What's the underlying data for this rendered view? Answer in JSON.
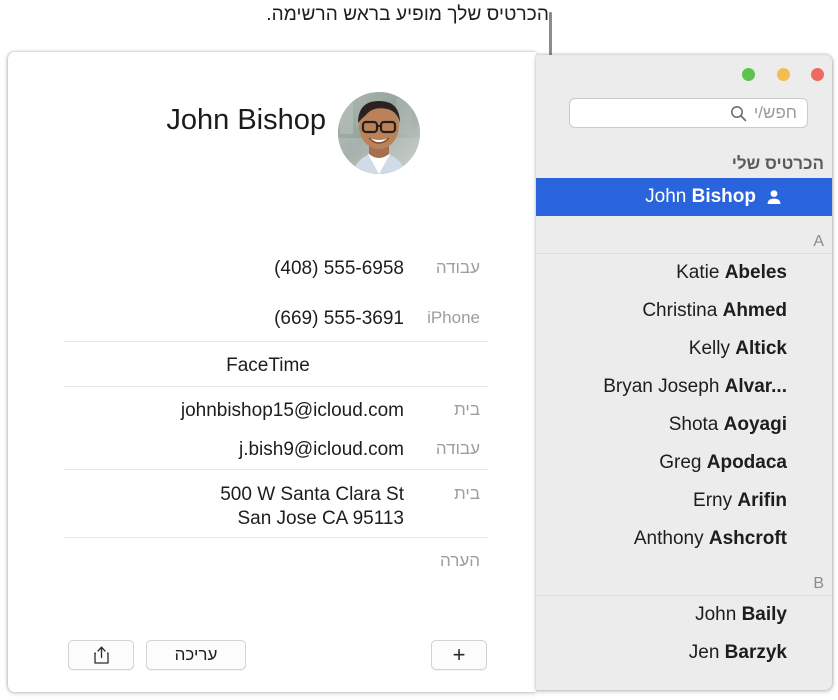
{
  "callout": {
    "text": "הכרטיס שלך מופיע בראש הרשימה."
  },
  "card": {
    "name": "John Bishop",
    "avatar_icon": "contact-photo",
    "fields": [
      {
        "label": "עבודה",
        "value": "(408) 555-6958",
        "type": "phone"
      },
      {
        "label": "iPhone",
        "value": "(669) 555-3691",
        "type": "phone"
      },
      {
        "label": "",
        "value": "FaceTime",
        "type": "facetime"
      },
      {
        "label": "בית",
        "value": "johnbishop15@icloud.com",
        "type": "email"
      },
      {
        "label": "עבודה",
        "value": "j.bish9@icloud.com",
        "type": "email"
      },
      {
        "label": "בית",
        "value": "500 W Santa Clara St\nSan Jose CA 95113",
        "type": "address"
      },
      {
        "label": "הערה",
        "value": "",
        "type": "note"
      }
    ],
    "address_line1": "500 W Santa Clara St",
    "address_line2": "San Jose CA 95113",
    "toolbar": {
      "share_icon": "share-icon",
      "edit_label": "עריכה",
      "add_label": "+"
    }
  },
  "window": {
    "traffic_lights": {
      "green": "#5cc44c",
      "yellow": "#f4bd4f",
      "red": "#ec6a5f"
    },
    "search": {
      "placeholder": "חפש/י",
      "value": "",
      "icon": "search-icon"
    },
    "selection_color": "#2a64dd",
    "sections": [
      {
        "header": "הכרטיס שלי",
        "is_my_card": true,
        "rows": [
          {
            "first": "John",
            "last": "Bishop",
            "selected": true,
            "icon": "person-icon"
          }
        ]
      },
      {
        "header": "A",
        "is_my_card": false,
        "rows": [
          {
            "first": "Katie",
            "last": "Abeles",
            "selected": false
          },
          {
            "first": "Christina",
            "last": "Ahmed",
            "selected": false
          },
          {
            "first": "Kelly",
            "last": "Altick",
            "selected": false
          },
          {
            "first": "Bryan Joseph",
            "last": "Alvar...",
            "selected": false
          },
          {
            "first": "Shota",
            "last": "Aoyagi",
            "selected": false
          },
          {
            "first": "Greg",
            "last": "Apodaca",
            "selected": false
          },
          {
            "first": "Erny",
            "last": "Arifin",
            "selected": false
          },
          {
            "first": "Anthony",
            "last": "Ashcroft",
            "selected": false
          }
        ]
      },
      {
        "header": "B",
        "is_my_card": false,
        "rows": [
          {
            "first": "John",
            "last": "Baily",
            "selected": false
          },
          {
            "first": "Jen",
            "last": "Barzyk",
            "selected": false
          }
        ]
      }
    ]
  }
}
